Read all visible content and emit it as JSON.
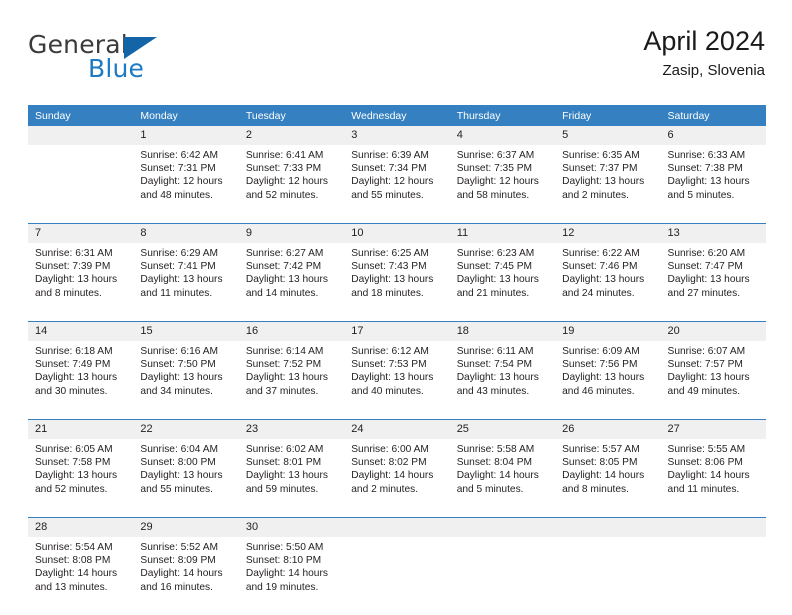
{
  "logo": {
    "word_one": "General",
    "word_two": "Blue",
    "triangle_icon": "blue-triangle-icon",
    "brand_blue": "#1c7bc4",
    "brand_dark": "#3b3b3b"
  },
  "header": {
    "title": "April 2024",
    "subtitle": "Zasip, Slovenia"
  },
  "colors": {
    "header_row_bg": "#3580c0",
    "daynum_bg": "#f0f0f0",
    "week_separator": "#3580c0",
    "text": "#231f20"
  },
  "weekday_headers": [
    "Sunday",
    "Monday",
    "Tuesday",
    "Wednesday",
    "Thursday",
    "Friday",
    "Saturday"
  ],
  "weeks": [
    {
      "days": [
        {
          "num": "",
          "sunrise": "",
          "sunset": "",
          "daylight_1": "",
          "daylight_2": ""
        },
        {
          "num": "1",
          "sunrise": "Sunrise: 6:42 AM",
          "sunset": "Sunset: 7:31 PM",
          "daylight_1": "Daylight: 12 hours",
          "daylight_2": "and 48 minutes."
        },
        {
          "num": "2",
          "sunrise": "Sunrise: 6:41 AM",
          "sunset": "Sunset: 7:33 PM",
          "daylight_1": "Daylight: 12 hours",
          "daylight_2": "and 52 minutes."
        },
        {
          "num": "3",
          "sunrise": "Sunrise: 6:39 AM",
          "sunset": "Sunset: 7:34 PM",
          "daylight_1": "Daylight: 12 hours",
          "daylight_2": "and 55 minutes."
        },
        {
          "num": "4",
          "sunrise": "Sunrise: 6:37 AM",
          "sunset": "Sunset: 7:35 PM",
          "daylight_1": "Daylight: 12 hours",
          "daylight_2": "and 58 minutes."
        },
        {
          "num": "5",
          "sunrise": "Sunrise: 6:35 AM",
          "sunset": "Sunset: 7:37 PM",
          "daylight_1": "Daylight: 13 hours",
          "daylight_2": "and 2 minutes."
        },
        {
          "num": "6",
          "sunrise": "Sunrise: 6:33 AM",
          "sunset": "Sunset: 7:38 PM",
          "daylight_1": "Daylight: 13 hours",
          "daylight_2": "and 5 minutes."
        }
      ]
    },
    {
      "days": [
        {
          "num": "7",
          "sunrise": "Sunrise: 6:31 AM",
          "sunset": "Sunset: 7:39 PM",
          "daylight_1": "Daylight: 13 hours",
          "daylight_2": "and 8 minutes."
        },
        {
          "num": "8",
          "sunrise": "Sunrise: 6:29 AM",
          "sunset": "Sunset: 7:41 PM",
          "daylight_1": "Daylight: 13 hours",
          "daylight_2": "and 11 minutes."
        },
        {
          "num": "9",
          "sunrise": "Sunrise: 6:27 AM",
          "sunset": "Sunset: 7:42 PM",
          "daylight_1": "Daylight: 13 hours",
          "daylight_2": "and 14 minutes."
        },
        {
          "num": "10",
          "sunrise": "Sunrise: 6:25 AM",
          "sunset": "Sunset: 7:43 PM",
          "daylight_1": "Daylight: 13 hours",
          "daylight_2": "and 18 minutes."
        },
        {
          "num": "11",
          "sunrise": "Sunrise: 6:23 AM",
          "sunset": "Sunset: 7:45 PM",
          "daylight_1": "Daylight: 13 hours",
          "daylight_2": "and 21 minutes."
        },
        {
          "num": "12",
          "sunrise": "Sunrise: 6:22 AM",
          "sunset": "Sunset: 7:46 PM",
          "daylight_1": "Daylight: 13 hours",
          "daylight_2": "and 24 minutes."
        },
        {
          "num": "13",
          "sunrise": "Sunrise: 6:20 AM",
          "sunset": "Sunset: 7:47 PM",
          "daylight_1": "Daylight: 13 hours",
          "daylight_2": "and 27 minutes."
        }
      ]
    },
    {
      "days": [
        {
          "num": "14",
          "sunrise": "Sunrise: 6:18 AM",
          "sunset": "Sunset: 7:49 PM",
          "daylight_1": "Daylight: 13 hours",
          "daylight_2": "and 30 minutes."
        },
        {
          "num": "15",
          "sunrise": "Sunrise: 6:16 AM",
          "sunset": "Sunset: 7:50 PM",
          "daylight_1": "Daylight: 13 hours",
          "daylight_2": "and 34 minutes."
        },
        {
          "num": "16",
          "sunrise": "Sunrise: 6:14 AM",
          "sunset": "Sunset: 7:52 PM",
          "daylight_1": "Daylight: 13 hours",
          "daylight_2": "and 37 minutes."
        },
        {
          "num": "17",
          "sunrise": "Sunrise: 6:12 AM",
          "sunset": "Sunset: 7:53 PM",
          "daylight_1": "Daylight: 13 hours",
          "daylight_2": "and 40 minutes."
        },
        {
          "num": "18",
          "sunrise": "Sunrise: 6:11 AM",
          "sunset": "Sunset: 7:54 PM",
          "daylight_1": "Daylight: 13 hours",
          "daylight_2": "and 43 minutes."
        },
        {
          "num": "19",
          "sunrise": "Sunrise: 6:09 AM",
          "sunset": "Sunset: 7:56 PM",
          "daylight_1": "Daylight: 13 hours",
          "daylight_2": "and 46 minutes."
        },
        {
          "num": "20",
          "sunrise": "Sunrise: 6:07 AM",
          "sunset": "Sunset: 7:57 PM",
          "daylight_1": "Daylight: 13 hours",
          "daylight_2": "and 49 minutes."
        }
      ]
    },
    {
      "days": [
        {
          "num": "21",
          "sunrise": "Sunrise: 6:05 AM",
          "sunset": "Sunset: 7:58 PM",
          "daylight_1": "Daylight: 13 hours",
          "daylight_2": "and 52 minutes."
        },
        {
          "num": "22",
          "sunrise": "Sunrise: 6:04 AM",
          "sunset": "Sunset: 8:00 PM",
          "daylight_1": "Daylight: 13 hours",
          "daylight_2": "and 55 minutes."
        },
        {
          "num": "23",
          "sunrise": "Sunrise: 6:02 AM",
          "sunset": "Sunset: 8:01 PM",
          "daylight_1": "Daylight: 13 hours",
          "daylight_2": "and 59 minutes."
        },
        {
          "num": "24",
          "sunrise": "Sunrise: 6:00 AM",
          "sunset": "Sunset: 8:02 PM",
          "daylight_1": "Daylight: 14 hours",
          "daylight_2": "and 2 minutes."
        },
        {
          "num": "25",
          "sunrise": "Sunrise: 5:58 AM",
          "sunset": "Sunset: 8:04 PM",
          "daylight_1": "Daylight: 14 hours",
          "daylight_2": "and 5 minutes."
        },
        {
          "num": "26",
          "sunrise": "Sunrise: 5:57 AM",
          "sunset": "Sunset: 8:05 PM",
          "daylight_1": "Daylight: 14 hours",
          "daylight_2": "and 8 minutes."
        },
        {
          "num": "27",
          "sunrise": "Sunrise: 5:55 AM",
          "sunset": "Sunset: 8:06 PM",
          "daylight_1": "Daylight: 14 hours",
          "daylight_2": "and 11 minutes."
        }
      ]
    },
    {
      "days": [
        {
          "num": "28",
          "sunrise": "Sunrise: 5:54 AM",
          "sunset": "Sunset: 8:08 PM",
          "daylight_1": "Daylight: 14 hours",
          "daylight_2": "and 13 minutes."
        },
        {
          "num": "29",
          "sunrise": "Sunrise: 5:52 AM",
          "sunset": "Sunset: 8:09 PM",
          "daylight_1": "Daylight: 14 hours",
          "daylight_2": "and 16 minutes."
        },
        {
          "num": "30",
          "sunrise": "Sunrise: 5:50 AM",
          "sunset": "Sunset: 8:10 PM",
          "daylight_1": "Daylight: 14 hours",
          "daylight_2": "and 19 minutes."
        },
        {
          "num": "",
          "sunrise": "",
          "sunset": "",
          "daylight_1": "",
          "daylight_2": ""
        },
        {
          "num": "",
          "sunrise": "",
          "sunset": "",
          "daylight_1": "",
          "daylight_2": ""
        },
        {
          "num": "",
          "sunrise": "",
          "sunset": "",
          "daylight_1": "",
          "daylight_2": ""
        },
        {
          "num": "",
          "sunrise": "",
          "sunset": "",
          "daylight_1": "",
          "daylight_2": ""
        }
      ]
    }
  ]
}
